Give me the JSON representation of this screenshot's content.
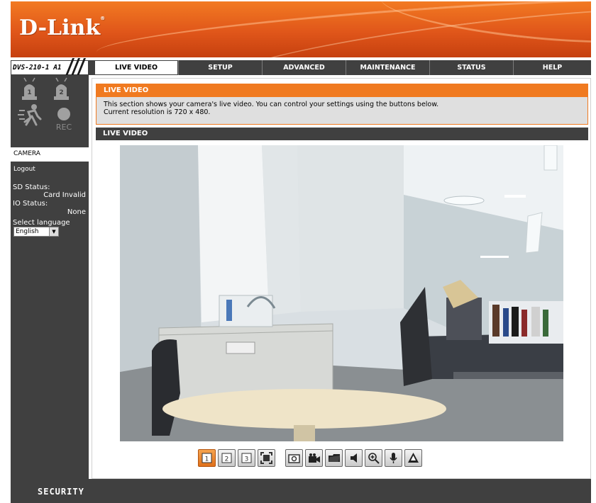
{
  "header": {
    "logo": "D-Link",
    "registered_mark": "®"
  },
  "nav": {
    "model": "DVS-210-1 A1",
    "tabs": [
      {
        "label": "LIVE VIDEO",
        "active": true
      },
      {
        "label": "SETUP",
        "active": false
      },
      {
        "label": "ADVANCED",
        "active": false
      },
      {
        "label": "MAINTENANCE",
        "active": false
      },
      {
        "label": "STATUS",
        "active": false
      },
      {
        "label": "HELP",
        "active": false
      }
    ]
  },
  "sidebar": {
    "alarm_icons": [
      "alarm-1-icon",
      "alarm-2-icon",
      "motion-icon",
      "rec-icon"
    ],
    "rec_label": "REC",
    "camera_label": "CAMERA",
    "logout_label": "Logout",
    "sd_status_label": "SD Status:",
    "sd_status_value": "Card Invalid",
    "io_status_label": "IO Status:",
    "io_status_value": "None",
    "language_label": "Select language",
    "language_value": "English"
  },
  "main": {
    "info_title": "LIVE VIDEO",
    "info_text_line1": "This section shows your camera's live video. You can control your settings using the buttons below.",
    "info_text_line2": "Current resolution is 720 x 480.",
    "video_section_title": "LIVE VIDEO"
  },
  "controls": {
    "buttons": [
      {
        "icon": "profile-1-icon",
        "label": "1",
        "active": true
      },
      {
        "icon": "profile-2-icon",
        "label": "2",
        "active": false
      },
      {
        "icon": "profile-3-icon",
        "label": "3",
        "active": false
      },
      {
        "icon": "fullscreen-icon",
        "active": false
      },
      {
        "icon": "snapshot-icon",
        "active": false
      },
      {
        "icon": "record-icon",
        "active": false
      },
      {
        "icon": "folder-icon",
        "active": false
      },
      {
        "icon": "speaker-icon",
        "active": false
      },
      {
        "icon": "zoom-icon",
        "active": false
      },
      {
        "icon": "microphone-icon",
        "active": false
      },
      {
        "icon": "alert-icon",
        "active": false
      }
    ]
  },
  "footer": {
    "label": "SECURITY"
  },
  "colors": {
    "brand_orange": "#f07a20",
    "dark_gray": "#404040",
    "info_bg": "#dfdfdf"
  }
}
